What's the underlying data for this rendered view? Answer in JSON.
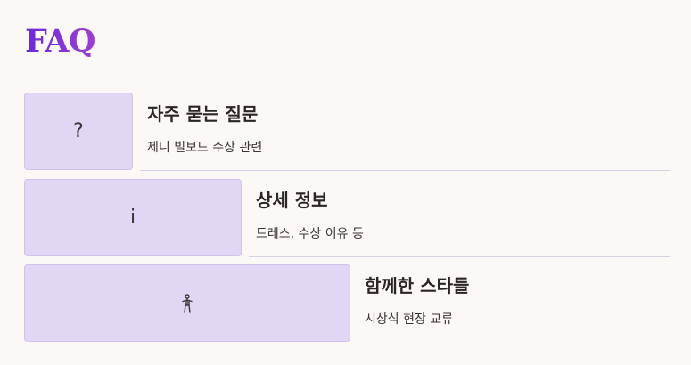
{
  "page": {
    "title": "FAQ"
  },
  "cards": [
    {
      "icon": "question-mark-icon",
      "icon_glyph": "?",
      "title": "자주 묻는 질문",
      "subtitle": "제니 빌보드 수상 관련"
    },
    {
      "icon": "info-icon",
      "icon_glyph": "i",
      "title": "상세 정보",
      "subtitle": "드레스, 수상 이유 등"
    },
    {
      "icon": "person-icon",
      "icon_glyph": "",
      "title": "함께한 스타들",
      "subtitle": "시상식 현장 교류"
    }
  ],
  "colors": {
    "background": "#fcf8f5",
    "title_gradient_start": "#6a2ad8",
    "title_gradient_end": "#9a3fd0",
    "thumb_fill": "#e1d7f5",
    "divider": "#d7d0e4"
  }
}
